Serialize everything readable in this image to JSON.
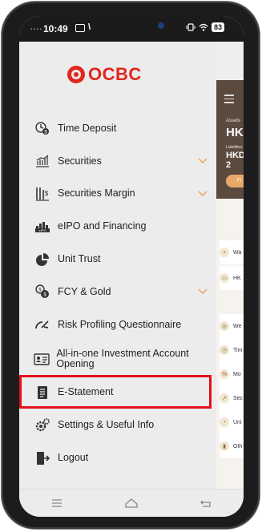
{
  "status_bar": {
    "time": "10:49",
    "dots": "....",
    "misc": "\\",
    "battery": "83"
  },
  "brand": {
    "name": "OCBC",
    "color": "#e1261c"
  },
  "menu": {
    "items": [
      {
        "label": "Time Deposit",
        "icon": "time-deposit-icon",
        "has_chevron": false
      },
      {
        "label": "Securities",
        "icon": "securities-chart-icon",
        "has_chevron": true
      },
      {
        "label": "Securities Margin",
        "icon": "securities-margin-icon",
        "has_chevron": true
      },
      {
        "label": "eIPO and Financing",
        "icon": "eipo-icon",
        "has_chevron": false
      },
      {
        "label": "Unit Trust",
        "icon": "unit-trust-pie-icon",
        "has_chevron": false
      },
      {
        "label": "FCY & Gold",
        "icon": "fcy-gold-icon",
        "has_chevron": true
      },
      {
        "label": "Risk Profiling Questionnaire",
        "icon": "risk-gauge-icon",
        "has_chevron": false
      },
      {
        "label": "All-in-one Investment Account Opening",
        "icon": "account-opening-icon",
        "has_chevron": false
      },
      {
        "label": "E-Statement",
        "icon": "statement-document-icon",
        "has_chevron": false,
        "highlighted": true
      },
      {
        "label": "Settings & Useful Info",
        "icon": "settings-gear-icon",
        "has_chevron": false
      },
      {
        "label": "Logout",
        "icon": "logout-icon",
        "has_chevron": false
      }
    ],
    "chevron_color": "#e8a35c",
    "highlight_color": "#e3101a"
  },
  "background_panel": {
    "assets_label": "Assets",
    "assets_currency": "HKD",
    "liabilities_label": "Liabilities",
    "liabilities_value": "HKD 2",
    "pill_label": "Fl",
    "rows": [
      {
        "label": "Wa",
        "icon": "wallet-icon"
      },
      {
        "label": "HK",
        "icon": "card-icon"
      },
      {
        "label": "We",
        "icon": "wealth-icon"
      },
      {
        "label": "Tim",
        "icon": "clock-icon"
      },
      {
        "label": "Mo",
        "icon": "percent-icon"
      },
      {
        "label": "Sec",
        "icon": "chart-icon"
      },
      {
        "label": "Uni",
        "icon": "pie-icon"
      },
      {
        "label": "Oth",
        "icon": "bars-icon"
      }
    ],
    "header_color": "#5b4a3e",
    "accent_color": "#e9a968"
  },
  "nav_bar": {
    "buttons": [
      "menu-nav-icon",
      "home-nav-icon",
      "back-nav-icon"
    ]
  }
}
